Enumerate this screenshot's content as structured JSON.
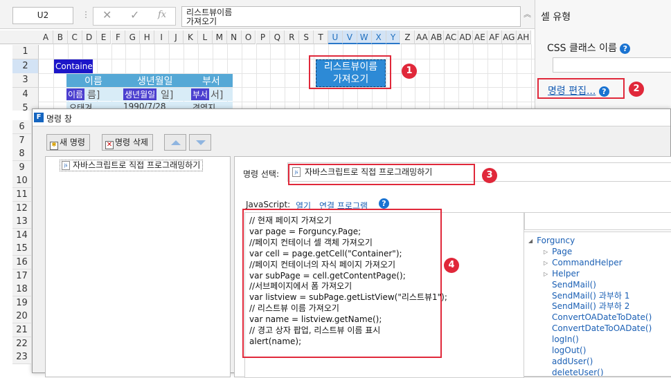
{
  "formula_bar": {
    "cell_ref": "U2",
    "cancel_icon": "✕",
    "confirm_icon": "✓",
    "fx_label": "fx",
    "line1": "리스트뷰이름",
    "line2": "가져오기"
  },
  "right_panel": {
    "title": "셀 유형",
    "css_label": "CSS 클래스 이름",
    "edit_command_label": "명령 편집...",
    "help_glyph": "?"
  },
  "sheet": {
    "columns": [
      "A",
      "B",
      "C",
      "D",
      "E",
      "F",
      "G",
      "H",
      "I",
      "J",
      "K",
      "L",
      "M",
      "N",
      "O",
      "P",
      "Q",
      "R",
      "S",
      "T",
      "U",
      "V",
      "W",
      "X",
      "Y",
      "Z",
      "AA",
      "AB",
      "AC",
      "AD",
      "AE",
      "AF",
      "AG",
      "AH"
    ],
    "rows": [
      "1",
      "2",
      "3",
      "4",
      "5"
    ],
    "container_label": "Container",
    "table_headers": [
      "이름",
      "생년월일",
      "부서"
    ],
    "bind_cells": [
      "이름",
      "생년월일",
      "부서"
    ],
    "bind_suffixes": [
      "름]",
      "일]",
      "서]"
    ],
    "data_row": [
      "오태겨",
      "1990/7/28",
      "경영지"
    ],
    "button_line1": "리스트뷰이름",
    "button_line2": "가져오기"
  },
  "badges": [
    "1",
    "2",
    "3",
    "4"
  ],
  "dialog": {
    "title": "명령 창",
    "new_command": "새 명령",
    "delete_command": "명령 삭제",
    "command_item": "자바스크립트로 직접 프로그래밍하기",
    "command_select_label": "명령 선택:",
    "selected_command": "자바스크립트로 직접 프로그래밍하기",
    "js_label": "JavaScript:",
    "open_link": "열기",
    "connect_link": "연결 프로그램",
    "row_numbers": [
      "6",
      "7",
      "8",
      "9",
      "10",
      "11",
      "12",
      "13",
      "14",
      "15",
      "16",
      "17",
      "18",
      "19",
      "20",
      "21",
      "22",
      "23"
    ],
    "code_lines": [
      "// 현재 페이지 가져오기",
      "var page = Forguncy.Page;",
      "//페이지 컨테이너 셀 객체 가져오기",
      "var cell = page.getCell(\"Container\");",
      "//페이지 컨테이너의 자식 페이지 가져오기",
      "var subPage = cell.getContentPage();",
      "//서브페이지에서 폼 가져오기",
      "var listview = subPage.getListView(\"리스트뷰1\");",
      "// 리스트뷰 이름 가져오기",
      "var name = listview.getName();",
      "// 경고 상자 팝업, 리스트뷰 이름 표시",
      "alert(name);"
    ],
    "tree": [
      {
        "label": "Forguncy",
        "arrow": "◢"
      },
      {
        "label": "Page",
        "arrow": "▷"
      },
      {
        "label": "CommandHelper",
        "arrow": "▷"
      },
      {
        "label": "Helper",
        "arrow": "▷"
      },
      {
        "label": "SendMail()",
        "arrow": ""
      },
      {
        "label": "SendMail() 과부하 1",
        "arrow": ""
      },
      {
        "label": "SendMail() 과부하 2",
        "arrow": ""
      },
      {
        "label": "ConvertOADateToDate()",
        "arrow": ""
      },
      {
        "label": "ConvertDateToOADate()",
        "arrow": ""
      },
      {
        "label": "logIn()",
        "arrow": ""
      },
      {
        "label": "logOut()",
        "arrow": ""
      },
      {
        "label": "addUser()",
        "arrow": ""
      },
      {
        "label": "deleteUser()",
        "arrow": ""
      }
    ]
  }
}
